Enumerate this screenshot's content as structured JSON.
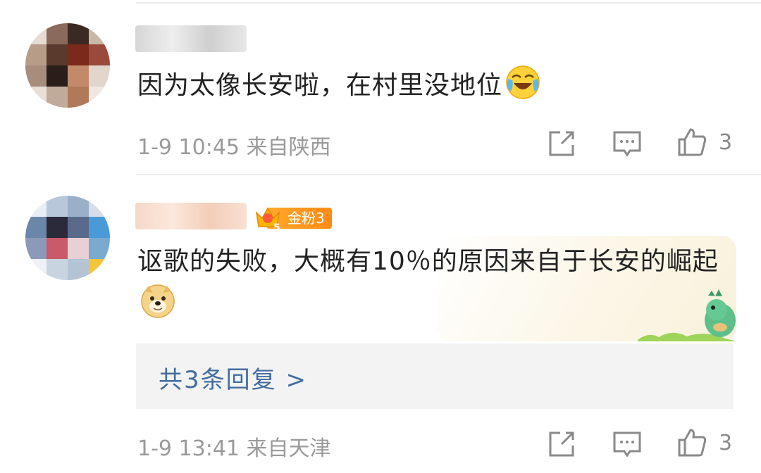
{
  "comments": [
    {
      "text": "因为太像长安啦，在村里没地位",
      "emoji": "laughing-crying-emoji",
      "time": "1-9 10:45",
      "location": "来自陕西",
      "likes": "3"
    },
    {
      "text": "讴歌的失败，大概有10％的原因来自于长安的崛起",
      "emoji": "doge-emoji",
      "badge": {
        "level": "5",
        "label": "金粉3"
      },
      "replies_link": "共3条回复 >",
      "time": "1-9 13:41",
      "location": "来自天津",
      "likes": "3"
    }
  ],
  "icons": [
    "share-icon",
    "comment-icon",
    "like-icon",
    "crown-icon"
  ],
  "colors": {
    "link": "#436d9e",
    "text": "#222222",
    "meta": "#9a9a9a",
    "badge": "#ff9a1f"
  }
}
